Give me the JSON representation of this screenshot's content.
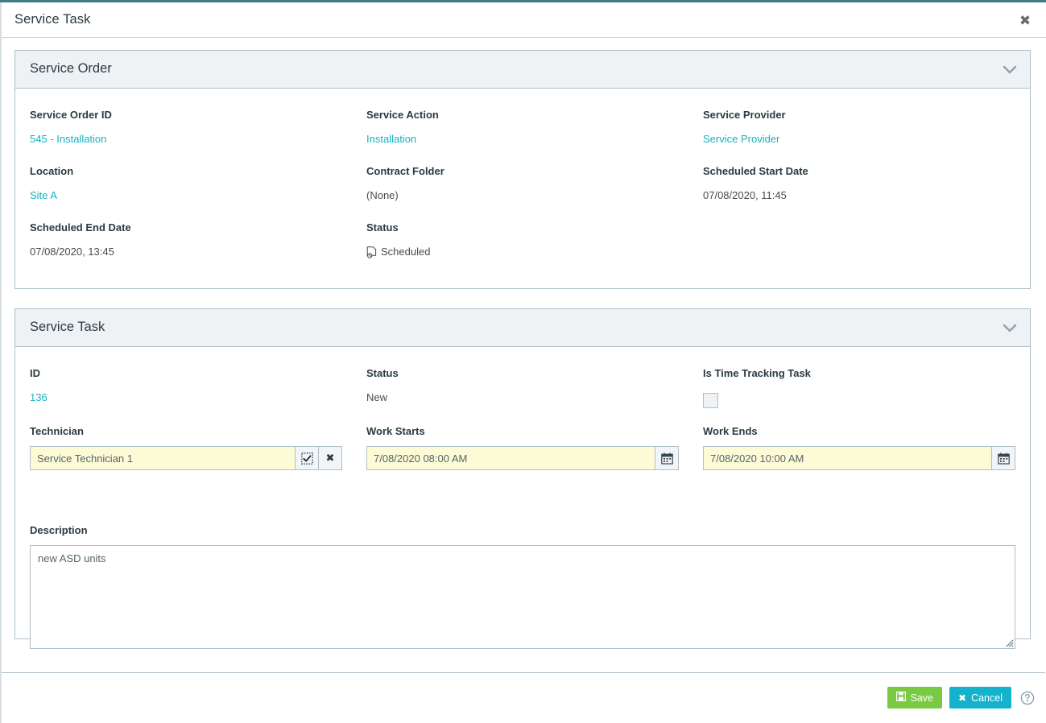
{
  "theme": {
    "accent_top_bar": "#3d7b88",
    "link_color": "#17b2c3",
    "panel_header_bg": "#eef2f5",
    "panel_border": "#aebfc9",
    "input_bg": "#fdfbd5",
    "save_button_color": "#79c943",
    "cancel_button_color": "#14b2cc"
  },
  "dialog": {
    "title": "Service Task",
    "close_label": "✖"
  },
  "panels": [
    {
      "title": "Service Order",
      "collapse_icon": "chevron-down-icon"
    },
    {
      "title": "Service Task",
      "collapse_icon": "chevron-down-icon"
    }
  ],
  "service_order": {
    "fields": {
      "service_order_id": {
        "label": "Service Order ID",
        "value": "545 - Installation",
        "type": "link"
      },
      "service_action": {
        "label": "Service Action",
        "value": "Installation",
        "type": "link"
      },
      "service_provider": {
        "label": "Service Provider",
        "value": "Service Provider",
        "type": "link"
      },
      "location": {
        "label": "Location",
        "value": "Site A",
        "type": "link"
      },
      "contract_folder": {
        "label": "Contract Folder",
        "value": "(None)",
        "type": "text"
      },
      "scheduled_start_date": {
        "label": "Scheduled Start Date",
        "value": "07/08/2020, 11:45",
        "type": "text"
      },
      "scheduled_end_date": {
        "label": "Scheduled End Date",
        "value": "07/08/2020, 13:45",
        "type": "text"
      },
      "status": {
        "label": "Status",
        "value": "Scheduled",
        "type": "status",
        "icon": "scheduled-document-clock-icon"
      }
    }
  },
  "service_task": {
    "fields": {
      "id": {
        "label": "ID",
        "value": "136",
        "type": "link"
      },
      "status": {
        "label": "Status",
        "value": "New",
        "type": "text"
      },
      "is_time_tracking_task": {
        "label": "Is Time Tracking Task",
        "checked": false
      },
      "technician": {
        "label": "Technician",
        "value": "Service Technician 1",
        "placeholder": "",
        "select_button_icon": "select-record-icon",
        "clear_button_icon": "clear-icon",
        "clear_button_label": "✖"
      },
      "work_starts": {
        "label": "Work Starts",
        "value": "7/08/2020 08:00 AM",
        "placeholder": "",
        "calendar_button_icon": "calendar-icon"
      },
      "work_ends": {
        "label": "Work Ends",
        "value": "7/08/2020 10:00 AM",
        "placeholder": "",
        "calendar_button_icon": "calendar-icon"
      },
      "description": {
        "label": "Description",
        "value": "new ASD units",
        "placeholder": ""
      }
    }
  },
  "footer": {
    "save_label": "Save",
    "save_icon": "save-floppy-icon",
    "cancel_label": "Cancel",
    "cancel_icon": "cancel-x-icon",
    "cancel_glyph": "✖",
    "help_icon": "help-circle-icon"
  }
}
